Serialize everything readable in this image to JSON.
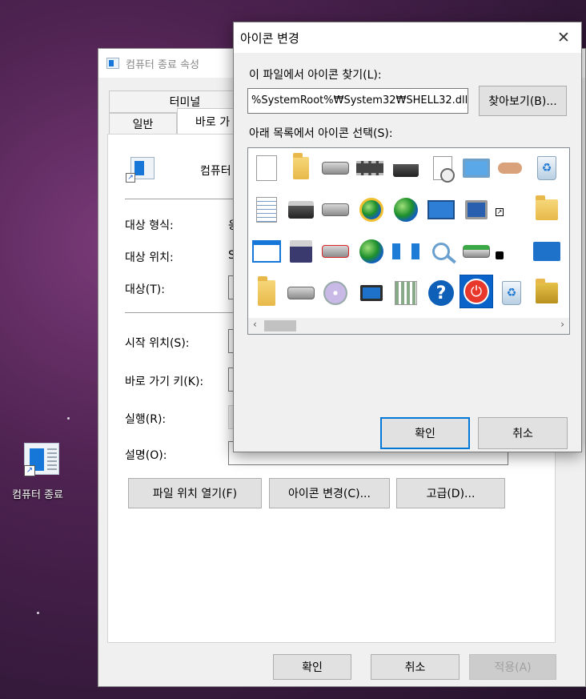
{
  "desktop": {
    "shortcut_label": "컴퓨터 종료"
  },
  "props_dialog": {
    "title": "컴퓨터 종료 속성",
    "tabs": [
      {
        "label": "터미널"
      },
      {
        "label": "일반"
      },
      {
        "label": "바로 가"
      }
    ],
    "shortcut_name": "컴퓨터",
    "fields": {
      "target_type_label": "대상 형식:",
      "target_type_value": "응",
      "target_location_label": "대상 위치:",
      "target_location_value": "S",
      "target_label": "대상(T):",
      "start_in_label": "시작 위치(S):",
      "shortcut_key_label": "바로 가기 키(K):",
      "run_label": "실행(R):",
      "comment_label": "설명(O):"
    },
    "buttons": {
      "open_location": "파일 위치 열기(F)",
      "change_icon": "아이콘 변경(C)...",
      "advanced": "고급(D)..."
    },
    "footer": {
      "ok": "확인",
      "cancel": "취소",
      "apply": "적용(A)"
    }
  },
  "change_icon_dialog": {
    "title": "아이콘 변경",
    "close_glyph": "✕",
    "find_label": "이 파일에서 아이콘 찾기(L):",
    "path_value": "%SystemRoot%₩System32₩SHELL32.dll",
    "browse_label": "찾아보기(B)...",
    "select_label": "아래 목록에서 아이콘 선택(S):",
    "ok": "확인",
    "cancel": "취소",
    "selected_icon": "power-icon",
    "icons": [
      [
        "document-icon",
        "folder-icon",
        "drive-icon",
        "memory-chip-icon",
        "printer-icon",
        "clock-document-icon",
        "display-icon",
        "sharing-hand-icon",
        "recycle-bin-icon"
      ],
      [
        "text-document-icon",
        "drive-network-icon",
        "network-drive-icon",
        "globe-ie-icon",
        "internet-globe-icon",
        "control-panel-icon",
        "display-settings-icon",
        "shortcut-arrow-icon",
        "shared-folder-icon"
      ],
      [
        "application-window-icon",
        "floppy-icon",
        "disconnected-drive-icon",
        "globe-mouse-icon",
        "network-icon",
        "search-icon",
        "green-arrow-drive-icon",
        "recent-clock-icon",
        "desktop-blue-icon"
      ],
      [
        "folder-tall-icon",
        "removable-drive-icon",
        "cd-drive-icon",
        "computer-icon",
        "grid-folder-icon",
        "help-icon",
        "power-icon",
        "recycle-bin-empty-icon",
        "tools-folder-icon"
      ]
    ]
  },
  "colors": {
    "accent": "#0078d7",
    "selection": "#0a63c9",
    "power_red": "#e8382c"
  }
}
